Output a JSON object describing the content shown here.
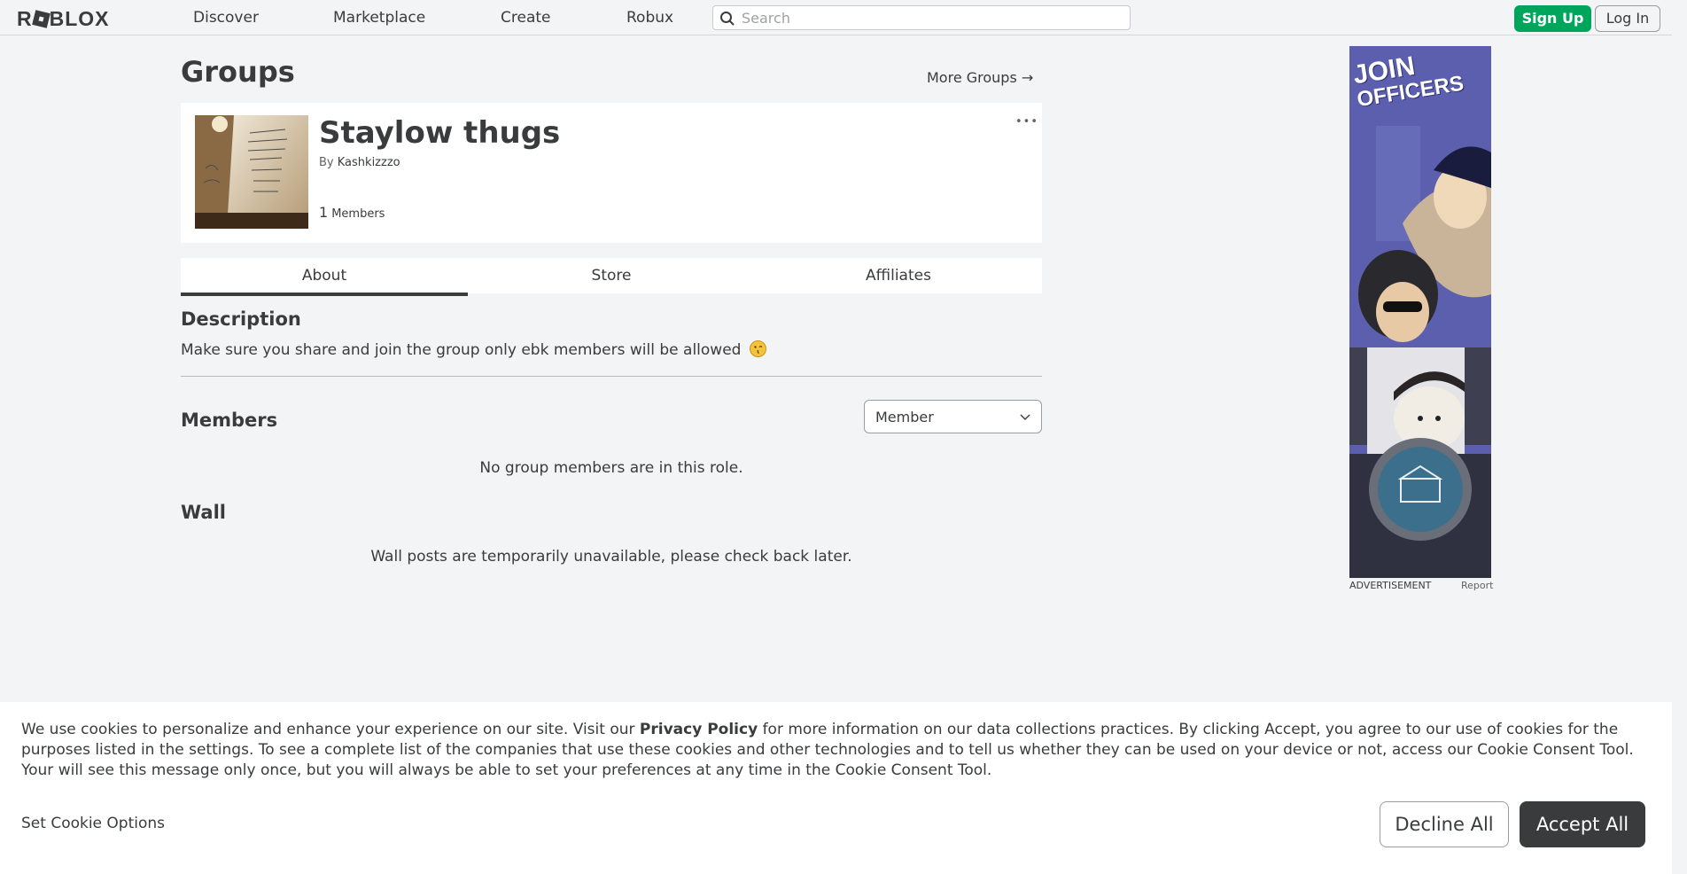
{
  "nav": {
    "logo": "ROBLOX",
    "links": [
      "Discover",
      "Marketplace",
      "Create",
      "Robux"
    ],
    "search_placeholder": "Search",
    "signup_label": "Sign Up",
    "login_label": "Log In"
  },
  "page": {
    "title": "Groups",
    "more_groups": "More Groups →"
  },
  "group": {
    "name": "Staylow thugs",
    "by_prefix": "By",
    "owner": "Kashkizzzo",
    "member_count": "1",
    "member_label": "Members",
    "more_menu": "•••"
  },
  "tabs": [
    {
      "label": "About",
      "active": true
    },
    {
      "label": "Store",
      "active": false
    },
    {
      "label": "Affiliates",
      "active": false
    }
  ],
  "about": {
    "description_heading": "Description",
    "description_text": "Make sure you share and join the group only ebk members will be allowed",
    "members_heading": "Members",
    "role_selected": "Member",
    "members_empty": "No group members are in this role.",
    "wall_heading": "Wall",
    "wall_empty": "Wall posts are temporarily unavailable, please check back later."
  },
  "ad": {
    "headline_line1": "JOIN",
    "headline_line2": "OFFICERS",
    "label": "ADVERTISEMENT",
    "report": "Report"
  },
  "cookie": {
    "text_before_link": "We use cookies to personalize and enhance your experience on our site. Visit our ",
    "link": "Privacy Policy",
    "text_after_link": " for more information on our data collections practices. By clicking Accept, you agree to our use of cookies for the purposes listed in the settings. To see a complete list of the companies that use these cookies and other technologies and to tell us whether they can be used on your device or not, access our Cookie Consent Tool. Your will see this message only once, but you will always be able to set your preferences at any time in the Cookie Consent Tool.",
    "options_label": "Set Cookie Options",
    "decline_label": "Decline All",
    "accept_label": "Accept All"
  }
}
